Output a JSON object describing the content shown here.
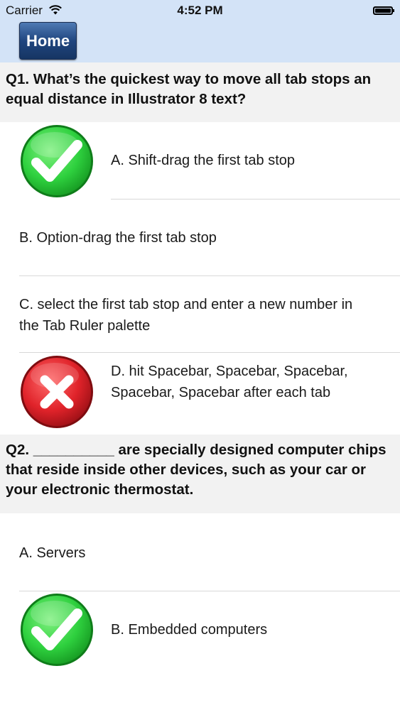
{
  "status_bar": {
    "carrier": "Carrier",
    "time": "4:52 PM"
  },
  "nav": {
    "home_label": "Home"
  },
  "questions": [
    {
      "text": "Q1. What’s the quickest way to move all tab stops an equal distance in Illustrator 8 text?",
      "answers": [
        {
          "label": "A. Shift-drag the first tab stop",
          "mark": "correct-check-icon"
        },
        {
          "label": "B. Option-drag the first tab stop",
          "mark": ""
        },
        {
          "label": "C. select the first tab stop and enter a new number in the Tab Ruler palette",
          "mark": ""
        },
        {
          "label": "D. hit Spacebar, Spacebar, Spacebar, Spacebar, Spacebar after each tab",
          "mark": "wrong-x-icon"
        }
      ]
    },
    {
      "text": "Q2. __________ are specially designed computer chips that reside inside other devices, such as your car or your electronic thermostat.",
      "answers": [
        {
          "label": "A. Servers",
          "mark": ""
        },
        {
          "label": "B. Embedded computers",
          "mark": "correct-check-icon"
        }
      ]
    }
  ],
  "colors": {
    "header_bg": "#d3e3f7",
    "question_bg": "#f2f2f2",
    "correct": "#2fd13f",
    "wrong": "#e0232a"
  }
}
